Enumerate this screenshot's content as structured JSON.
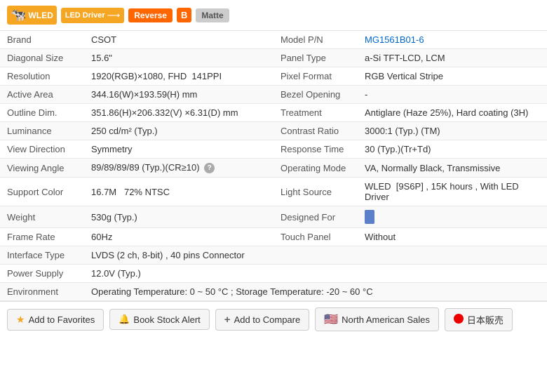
{
  "header": {
    "badges": [
      {
        "id": "wled",
        "label": "WLED",
        "style": "wled"
      },
      {
        "id": "led-driver",
        "label": "LED Driver",
        "style": "led-driver"
      },
      {
        "id": "reverse",
        "label": "Reverse",
        "style": "reverse"
      },
      {
        "id": "b",
        "label": "B",
        "style": "b"
      },
      {
        "id": "matte",
        "label": "Matte",
        "style": "matte"
      }
    ]
  },
  "specs": {
    "rows": [
      {
        "left_label": "Brand",
        "left_value": "CSOT",
        "right_label": "Model P/N",
        "right_value": "MG1561B01-6",
        "right_value_link": true
      },
      {
        "left_label": "Diagonal Size",
        "left_value": "15.6\"",
        "right_label": "Panel Type",
        "right_value": "a-Si TFT-LCD, LCM"
      },
      {
        "left_label": "Resolution",
        "left_value": "1920(RGB)×1080, FHD  141PPI",
        "right_label": "Pixel Format",
        "right_value": "RGB Vertical Stripe"
      },
      {
        "left_label": "Active Area",
        "left_value": "344.16(W)×193.59(H) mm",
        "right_label": "Bezel Opening",
        "right_value": "-"
      },
      {
        "left_label": "Outline Dim.",
        "left_value": "351.86(H)×206.332(V) ×6.31(D) mm",
        "right_label": "Treatment",
        "right_value": "Antiglare (Haze 25%), Hard coating (3H)"
      },
      {
        "left_label": "Luminance",
        "left_value": "250 cd/m² (Typ.)",
        "right_label": "Contrast Ratio",
        "right_value": "3000:1 (Typ.) (TM)"
      },
      {
        "left_label": "View Direction",
        "left_value": "Symmetry",
        "right_label": "Response Time",
        "right_value": "30 (Typ.)(Tr+Td)"
      },
      {
        "left_label": "Viewing Angle",
        "left_value": "89/89/89/89 (Typ.)(CR≥10)",
        "left_has_help": true,
        "right_label": "Operating Mode",
        "right_value": "VA, Normally Black, Transmissive"
      },
      {
        "left_label": "Support Color",
        "left_value": "16.7M   72% NTSC",
        "right_label": "Light Source",
        "right_value": "WLED  [9S6P] , 15K hours , With LED Driver"
      },
      {
        "left_label": "Weight",
        "left_value": "530g (Typ.)",
        "right_label": "Designed For",
        "right_value": "",
        "right_has_phone_icon": true
      },
      {
        "left_label": "Frame Rate",
        "left_value": "60Hz",
        "right_label": "Touch Panel",
        "right_value": "Without"
      }
    ],
    "full_rows": [
      {
        "label": "Interface Type",
        "value": "LVDS (2 ch, 8-bit) , 40 pins Connector"
      },
      {
        "label": "Power Supply",
        "value": "12.0V (Typ.)"
      },
      {
        "label": "Environment",
        "value": "Operating Temperature: 0 ~ 50 °C ; Storage Temperature: -20 ~ 60 °C"
      }
    ]
  },
  "footer": {
    "buttons": [
      {
        "id": "favorites",
        "label": "Add to Favorites",
        "icon": "star"
      },
      {
        "id": "stock-alert",
        "label": "Book Stock Alert",
        "icon": "speaker"
      },
      {
        "id": "compare",
        "label": "Add to Compare",
        "icon": "plus"
      },
      {
        "id": "north-american-sales",
        "label": "North American Sales",
        "icon": "flag-us"
      },
      {
        "id": "japan-sales",
        "label": "日本販売",
        "icon": "circle-red"
      }
    ]
  }
}
